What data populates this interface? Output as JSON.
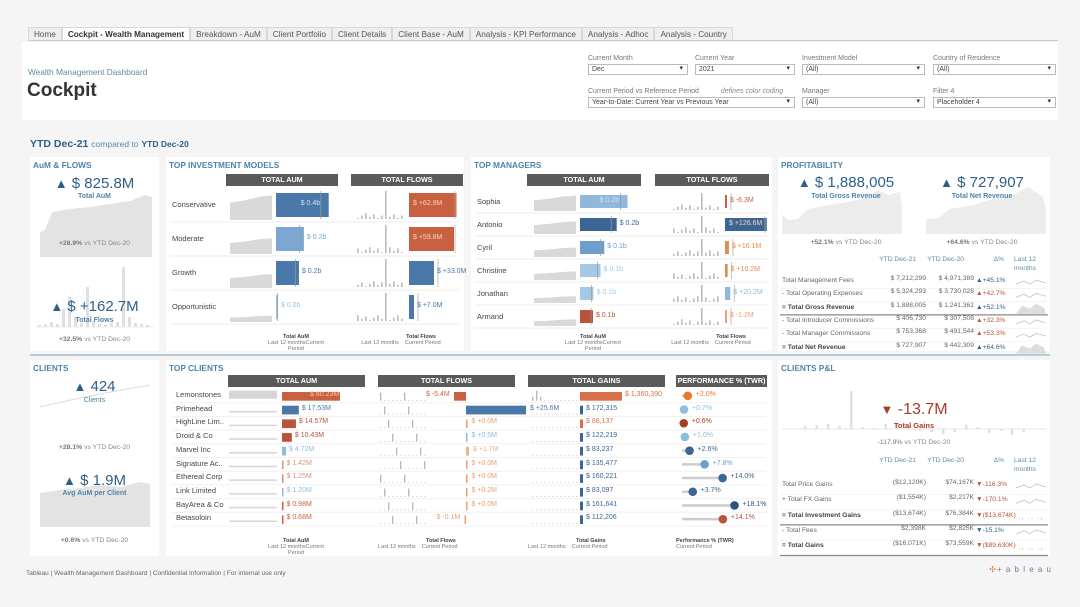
{
  "tabs": [
    "Home",
    "Cockpit - Wealth Management",
    "Breakdown - AuM",
    "Client Portfolio",
    "Client Details",
    "Client Base - AuM",
    "Analysis - KPI Performance",
    "Analysis - Adhoc",
    "Analysis - Country"
  ],
  "active_tab": 1,
  "header": {
    "subtitle": "Wealth Management Dashboard",
    "title": "Cockpit"
  },
  "filters": {
    "current_month": {
      "label": "Current Month",
      "value": "Dec"
    },
    "current_year": {
      "label": "Current Year",
      "value": "2021"
    },
    "investment_model": {
      "label": "Investment Model",
      "value": "(All)"
    },
    "country": {
      "label": "Country of Residence",
      "value": "(All)"
    },
    "period": {
      "label": "Current Period vs Reference Period",
      "note": "defines color coding",
      "value": "Year-to-Date: Current Year vs Previous Year"
    },
    "manager": {
      "label": "Manager",
      "value": "(All)"
    },
    "filter4": {
      "label": "Filter 4",
      "value": "Placeholder 4"
    }
  },
  "ytd": {
    "current": "YTD Dec-21",
    "compared": "compared to",
    "reference": "YTD Dec-20"
  },
  "aum_flows": {
    "title": "AuM & FLOWS",
    "aum_value": "$ 825.8M",
    "aum_label": "Total AuM",
    "aum_cmp_pct": "+28.9%",
    "aum_cmp_text": "vs YTD Dec-20",
    "flows_value": "$ +162.7M",
    "flows_label": "Total Flows",
    "flows_cmp_pct": "+32.5%",
    "flows_cmp_text": "vs YTD Dec-20"
  },
  "top_models": {
    "title": "TOP INVESTMENT MODELS",
    "aum_header": "TOTAL AUM",
    "flows_header": "TOTAL FLOWS",
    "rows": [
      {
        "name": "Conservative",
        "aum": "$ 0.4b",
        "aum_pct": 0.85,
        "aum_color": "#4a78a8",
        "flows": "$ +62.9M",
        "flows_pct": 0.95,
        "flows_color": "#c9603f"
      },
      {
        "name": "Moderate",
        "aum": "$ 0.2b",
        "aum_pct": 0.45,
        "aum_color": "#7ba7d0",
        "flows": "$ +59.8M",
        "flows_pct": 0.9,
        "flows_color": "#c9603f"
      },
      {
        "name": "Growth",
        "aum": "$ 0.2b",
        "aum_pct": 0.37,
        "aum_color": "#4a78a8",
        "flows": "$ +33.0M",
        "flows_pct": 0.5,
        "flows_color": "#4a78a8"
      },
      {
        "name": "Opportunistic",
        "aum": "$ 0.0b",
        "aum_pct": 0.03,
        "aum_color": "#9cc3e0",
        "flows": "$ +7.0M",
        "flows_pct": 0.1,
        "flows_color": "#4a78a8"
      }
    ],
    "foot_aum": "Total AuM",
    "foot_aum_sub": "Last 12 monthsCurrent Period",
    "foot_flows": "Total Flows",
    "foot_l12": "Last 12 months",
    "foot_cp": "Current Period"
  },
  "top_managers": {
    "title": "TOP MANAGERS",
    "aum_header": "TOTAL AUM",
    "flows_header": "TOTAL FLOWS",
    "rows": [
      {
        "name": "Sophia",
        "aum": "$ 0.2b",
        "aum_pct": 0.88,
        "aum_color": "#8fb8dc",
        "flows": "$ -6.3M",
        "flows_pct": 0.04,
        "flows_color": "#c9603f"
      },
      {
        "name": "Antonio",
        "aum": "$ 0.2b",
        "aum_pct": 0.68,
        "aum_color": "#3b6694",
        "flows": "$ +126.6M",
        "flows_pct": 0.95,
        "flows_color": "#3b6694"
      },
      {
        "name": "Cyril",
        "aum": "$ 0.1b",
        "aum_pct": 0.45,
        "aum_color": "#6e9fcc",
        "flows": "$ +16.1M",
        "flows_pct": 0.09,
        "flows_color": "#e58a4d"
      },
      {
        "name": "Christine",
        "aum": "$ 0.1b",
        "aum_pct": 0.38,
        "aum_color": "#a5c8e4",
        "flows": "$ +10.2M",
        "flows_pct": 0.06,
        "flows_color": "#e58a4d"
      },
      {
        "name": "Jonathan",
        "aum": "$ 0.1b",
        "aum_pct": 0.25,
        "aum_color": "#a5c8e4",
        "flows": "$ +20.2M",
        "flows_pct": 0.12,
        "flows_color": "#8fb8dc"
      },
      {
        "name": "Armand",
        "aum": "$ 0.1b",
        "aum_pct": 0.24,
        "aum_color": "#b9533a",
        "flows": "$ -1.2M",
        "flows_pct": 0.01,
        "flows_color": "#f0a070"
      }
    ],
    "foot_aum": "Total AuM",
    "foot_aum_sub": "Last 12 monthsCurrent Period",
    "foot_flows": "Total Flows",
    "foot_l12": "Last 12 months",
    "foot_cp": "Current Period"
  },
  "profitability": {
    "title": "PROFITABILITY",
    "gross_value": "$ 1,888,005",
    "gross_label": "Total Gross Revenue",
    "gross_cmp_pct": "+52.1%",
    "gross_cmp_text": "vs YTD Dec-20",
    "net_value": "$ 727,907",
    "net_label": "Total Net Revenue",
    "net_cmp_pct": "+64.6%",
    "net_cmp_text": "vs YTD Dec-20",
    "cols": [
      "YTD Dec-21",
      "YTD Dec-20",
      "Δ%",
      "Last 12 months"
    ],
    "rows": [
      {
        "label": "Total Management Fees",
        "cur": "$ 7,212,299",
        "ref": "$ 4,971,389",
        "delta": "+45.1%",
        "dir": "up",
        "color": "#2f5f88",
        "bold": false
      },
      {
        "label": "- Total Operating Expenses",
        "cur": "$ 5,324,293",
        "ref": "$ 3,730,028",
        "delta": "+42.7%",
        "dir": "up",
        "color": "#b9533a",
        "bold": false
      },
      {
        "label": "= Total Gross Revenue",
        "cur": "$ 1,888,005",
        "ref": "$ 1,241,362",
        "delta": "+52.1%",
        "dir": "up",
        "color": "#2f5f88",
        "bold": true
      },
      {
        "label": "- Total Introducer Commissions",
        "cur": "$ 406,730",
        "ref": "$ 307,508",
        "delta": "+32.3%",
        "dir": "up",
        "color": "#b9533a",
        "bold": false
      },
      {
        "label": "- Total Manager Commissions",
        "cur": "$ 753,368",
        "ref": "$ 491,544",
        "delta": "+53.3%",
        "dir": "up",
        "color": "#b9533a",
        "bold": false
      },
      {
        "label": "= Total Net Revenue",
        "cur": "$ 727,907",
        "ref": "$ 442,309",
        "delta": "+64.6%",
        "dir": "up",
        "color": "#2f5f88",
        "bold": true
      }
    ]
  },
  "clients": {
    "title": "CLIENTS",
    "count": "424",
    "count_label": "Clients",
    "count_cmp_pct": "+28.1%",
    "count_cmp_text": "vs YTD Dec-20",
    "avg_value": "$ 1.9M",
    "avg_label": "Avg AuM per Client",
    "avg_cmp_pct": "+0.6%",
    "avg_cmp_text": "vs YTD Dec-20"
  },
  "top_clients": {
    "title": "TOP CLIENTS",
    "aum_header": "TOTAL AUM",
    "flows_header": "TOTAL FLOWS",
    "gains_header": "TOTAL GAINS",
    "perf_header": "PERFORMANCE % (TWR)",
    "rows": [
      {
        "name": "Lemonstones",
        "aum": "$ 60.23M",
        "aum_pct": 1.0,
        "aum_color": "#c9603f",
        "flows": "$ -5.4M",
        "flows_pct": -0.2,
        "flows_color": "#c9603f",
        "gains": "$ 1,360,390",
        "gains_pct": 1.0,
        "gains_color": "#d9704a",
        "perf": "+2.0%",
        "perf_val": 2.0,
        "perf_color": "#e8782e"
      },
      {
        "name": "Primehead",
        "aum": "$ 17.53M",
        "aum_pct": 0.29,
        "aum_color": "#4a78a8",
        "flows": "$ +25.6M",
        "flows_pct": 1.0,
        "flows_color": "#4a78a8",
        "gains": "$ 172,315",
        "gains_pct": 0.13,
        "gains_color": "#3b6694",
        "perf": "+0.7%",
        "perf_val": 0.7,
        "perf_color": "#8fbde0"
      },
      {
        "name": "HighLine Lim..",
        "aum": "$ 14.57M",
        "aum_pct": 0.24,
        "aum_color": "#b9533a",
        "flows": "$ +0.0M",
        "flows_pct": 0.0,
        "flows_color": "#f0a070",
        "gains": "$ 88,137",
        "gains_pct": 0.07,
        "gains_color": "#d9704a",
        "perf": "+0.6%",
        "perf_val": 0.6,
        "perf_color": "#a83d25"
      },
      {
        "name": "Droid & Co",
        "aum": "$ 10.43M",
        "aum_pct": 0.17,
        "aum_color": "#b9533a",
        "flows": "$ +0.5M",
        "flows_pct": 0.02,
        "flows_color": "#8fb8dc",
        "gains": "$ 122,219",
        "gains_pct": 0.09,
        "gains_color": "#3b6694",
        "perf": "+1.0%",
        "perf_val": 1.0,
        "perf_color": "#8fbde0"
      },
      {
        "name": "Marvel Inc",
        "aum": "$ 4.72M",
        "aum_pct": 0.07,
        "aum_color": "#8fbde0",
        "flows": "$ +1.7M",
        "flows_pct": 0.05,
        "flows_color": "#f0b080",
        "gains": "$ 83,237",
        "gains_pct": 0.06,
        "gains_color": "#3b6694",
        "perf": "+2.6%",
        "perf_val": 2.6,
        "perf_color": "#3b6694"
      },
      {
        "name": "Signature Ac..",
        "aum": "$ 1.42M",
        "aum_pct": 0.02,
        "aum_color": "#d9917a",
        "flows": "$ +0.0M",
        "flows_pct": 0.0,
        "flows_color": "#f0a070",
        "gains": "$ 135,477",
        "gains_pct": 0.1,
        "gains_color": "#3b6694",
        "perf": "+7.8%",
        "perf_val": 7.8,
        "perf_color": "#6e9fcc"
      },
      {
        "name": "Ethereal Corp",
        "aum": "$ 1.25M",
        "aum_pct": 0.02,
        "aum_color": "#d9917a",
        "flows": "$ +0.0M",
        "flows_pct": 0.0,
        "flows_color": "#f0a070",
        "gains": "$ 160,221",
        "gains_pct": 0.12,
        "gains_color": "#3b6694",
        "perf": "+14.0%",
        "perf_val": 14.0,
        "perf_color": "#3b6694"
      },
      {
        "name": "Link Limited",
        "aum": "$ 1.20M",
        "aum_pct": 0.0,
        "aum_color": "#8fbde0",
        "flows": "$ +0.2M",
        "flows_pct": 0.0,
        "flows_color": "#f0a070",
        "gains": "$ 83,097",
        "gains_pct": 0.06,
        "gains_color": "#3b6694",
        "perf": "+3.7%",
        "perf_val": 3.7,
        "perf_color": "#3b6694"
      },
      {
        "name": "BayArea & Co",
        "aum": "$ 0.98M",
        "aum_pct": 0.0,
        "aum_color": "#c9603f",
        "flows": "$ +0.0M",
        "flows_pct": 0.0,
        "flows_color": "#f0a070",
        "gains": "$ 161,641",
        "gains_pct": 0.12,
        "gains_color": "#3b6694",
        "perf": "+18.1%",
        "perf_val": 18.1,
        "perf_color": "#2a5580"
      },
      {
        "name": "Betasoloin",
        "aum": "$ 0.68M",
        "aum_pct": 0.0,
        "aum_color": "#c9603f",
        "flows": "$ -0.1M",
        "flows_pct": -0.01,
        "flows_color": "#f0a070",
        "gains": "$ 112,206",
        "gains_pct": 0.08,
        "gains_color": "#3b6694",
        "perf": "+14.1%",
        "perf_val": 14.1,
        "perf_color": "#b9533a"
      }
    ],
    "foot_aum": "Total AuM",
    "foot_aum_sub": "Last 12 monthsCurrent Period",
    "foot_flows": "Total Flows",
    "foot_gains": "Total Gains",
    "foot_perf": "Performance % (TWR)",
    "foot_l12": "Last 12 months",
    "foot_cp": "Current Period"
  },
  "clients_pl": {
    "title": "CLIENTS P&L",
    "value": "-13.7M",
    "label": "Total Gains",
    "cmp_pct": "-117.9%",
    "cmp_text": "vs YTD Dec-20",
    "cols": [
      "YTD Dec-21",
      "YTD Dec-20",
      "Δ%",
      "Last 12 months"
    ],
    "rows": [
      {
        "label": "Total Price Gains",
        "cur": "($12,120K)",
        "ref": "$74,167K",
        "delta": "-116.3%",
        "dir": "down",
        "color": "#b9533a",
        "bold": false
      },
      {
        "label": "+ Total FX Gains",
        "cur": "($1,554K)",
        "ref": "$2,217K",
        "delta": "-170.1%",
        "dir": "down",
        "color": "#b9533a",
        "bold": false
      },
      {
        "label": "= Total Investment Gains",
        "cur": "($13,674K)",
        "ref": "$76,384K",
        "delta": "($13,674K)",
        "dir": "down",
        "color": "#b9533a",
        "bold": true
      },
      {
        "label": "- Total Fees",
        "cur": "$2,398K",
        "ref": "$2,825K",
        "delta": "-15.1%",
        "dir": "down",
        "color": "#2f5f88",
        "bold": false
      },
      {
        "label": "= Total Gains",
        "cur": "($16,071K)",
        "ref": "$73,559K",
        "delta": "($89,630K)",
        "dir": "down",
        "color": "#b9533a",
        "bold": true
      }
    ]
  },
  "footer": {
    "text": "Tableau | Wealth Management Dashboard | Confidential Information | For internal use only",
    "logo": "+ a b l e a u"
  }
}
